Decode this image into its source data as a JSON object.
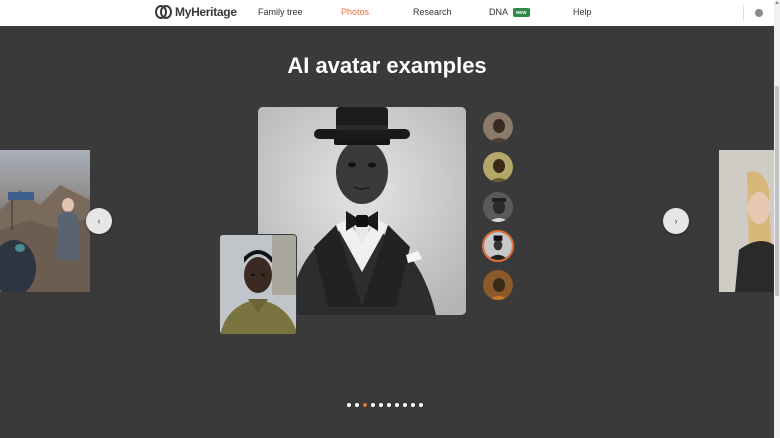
{
  "header": {
    "logo_text": "MyHeritage",
    "nav": [
      {
        "label": "Family tree",
        "active": false
      },
      {
        "label": "Photos",
        "active": true
      },
      {
        "label": "Research",
        "active": false
      },
      {
        "label": "DNA",
        "active": false,
        "badge": "NEW"
      },
      {
        "label": "Help",
        "active": false
      }
    ]
  },
  "section": {
    "title": "AI avatar examples"
  },
  "carousel": {
    "prev_glyph": "‹",
    "next_glyph": "›",
    "thumbnail_count": 5,
    "active_thumbnail": 4,
    "dot_count": 10,
    "active_dot": 3
  },
  "colors": {
    "accent": "#e2703a",
    "background": "#3a3a3a",
    "badge": "#2f8a4a"
  }
}
